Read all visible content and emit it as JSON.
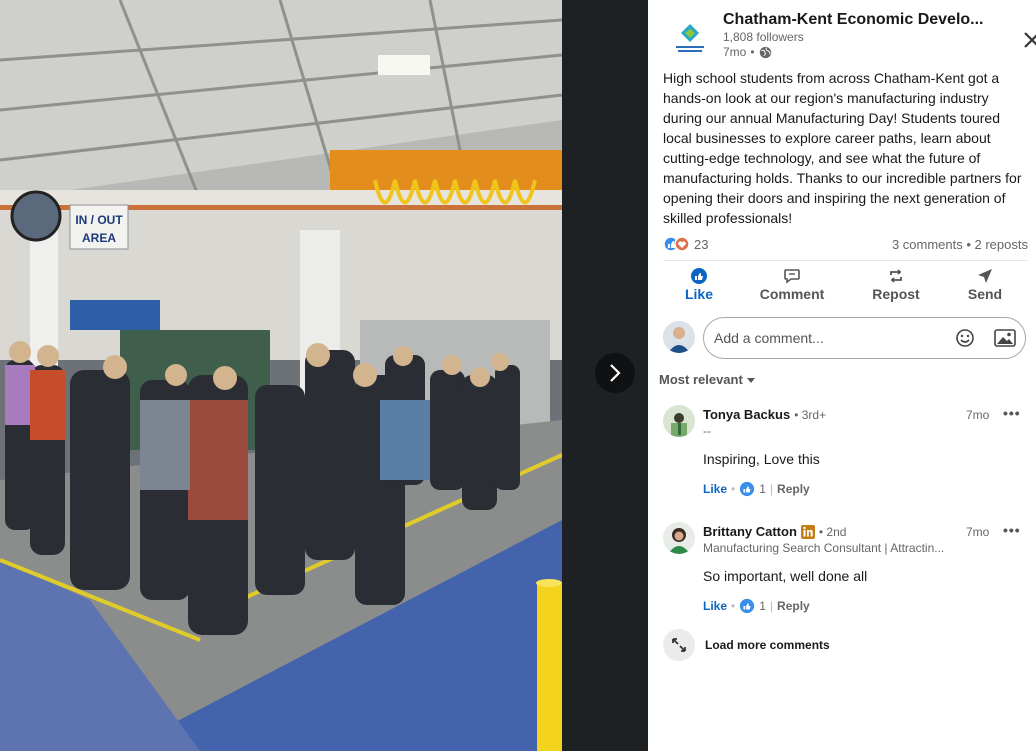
{
  "post": {
    "author": "Chatham-Kent Economic Develo...",
    "followers": "1,808 followers",
    "time": "7mo",
    "text": "High school students from across Chatham-Kent got a hands-on look at our region's manufacturing industry during our annual Manufacturing Day! Students toured local businesses to explore career paths, learn about cutting-edge technology, and see what the future of manufacturing holds. Thanks to our incredible partners for opening their doors and inspiring the next generation of skilled professionals!",
    "reaction_count": "23",
    "comments_reposts": "3 comments • 2 reposts",
    "photo_sign": "IN / OUT\nAREA"
  },
  "actions": {
    "like": "Like",
    "comment": "Comment",
    "repost": "Repost",
    "send": "Send"
  },
  "comment_input": {
    "placeholder": "Add a comment..."
  },
  "sort": {
    "label": "Most relevant"
  },
  "comments": [
    {
      "name": "Tonya Backus",
      "degree": "• 3rd+",
      "subtitle": "--",
      "time": "7mo",
      "text": "Inspiring, Love this",
      "like_label": "Like",
      "like_count": "1",
      "reply_label": "Reply"
    },
    {
      "name": "Brittany Catton",
      "degree": "• 2nd",
      "subtitle": "Manufacturing Search Consultant | Attractin...",
      "time": "7mo",
      "text": "So important, well done all",
      "like_label": "Like",
      "like_count": "1",
      "reply_label": "Reply"
    }
  ],
  "load_more": "Load more comments",
  "colors": {
    "linkedin_blue": "#0a66c2",
    "panel_bg": "#ffffff",
    "dark_bg": "#1e2124"
  }
}
